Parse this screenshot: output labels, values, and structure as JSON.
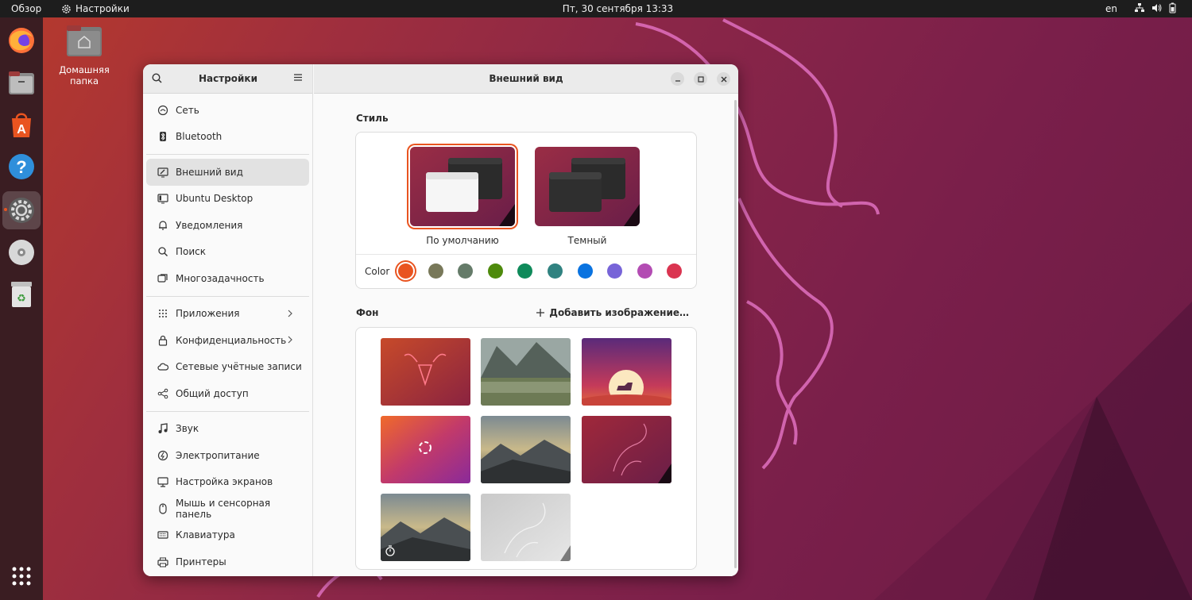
{
  "topbar": {
    "overview": "Обзор",
    "app_name": "Настройки",
    "clock": "Пт, 30 сентября  13:33",
    "lang": "en"
  },
  "desktop": {
    "home_folder": "Домашняя папка"
  },
  "dock": [
    "firefox-icon",
    "files-icon",
    "app-center-icon",
    "help-icon",
    "settings-icon",
    "disc-icon",
    "trash-icon",
    "show-apps-icon"
  ],
  "sidebar": {
    "title": "Настройки",
    "groups": [
      [
        {
          "label": "Сеть",
          "icon": "network-icon"
        },
        {
          "label": "Bluetooth",
          "icon": "bluetooth-icon"
        }
      ],
      [
        {
          "label": "Внешний вид",
          "icon": "appearance-icon",
          "selected": true
        },
        {
          "label": "Ubuntu Desktop",
          "icon": "ubuntu-desktop-icon"
        },
        {
          "label": "Уведомления",
          "icon": "bell-icon"
        },
        {
          "label": "Поиск",
          "icon": "search-icon"
        },
        {
          "label": "Многозадачность",
          "icon": "multitasking-icon"
        }
      ],
      [
        {
          "label": "Приложения",
          "icon": "apps-grid-icon",
          "chevron": true
        },
        {
          "label": "Конфиденциальность",
          "icon": "lock-icon",
          "chevron": true
        },
        {
          "label": "Сетевые учётные записи",
          "icon": "cloud-icon"
        },
        {
          "label": "Общий доступ",
          "icon": "share-icon"
        }
      ],
      [
        {
          "label": "Звук",
          "icon": "music-note-icon"
        },
        {
          "label": "Электропитание",
          "icon": "power-icon"
        },
        {
          "label": "Настройка экранов",
          "icon": "display-icon"
        },
        {
          "label": "Мышь и сенсорная панель",
          "icon": "mouse-icon"
        },
        {
          "label": "Клавиатура",
          "icon": "keyboard-icon"
        },
        {
          "label": "Принтеры",
          "icon": "printer-icon"
        }
      ]
    ]
  },
  "main": {
    "title": "Внешний вид",
    "style_label": "Стиль",
    "style_options": [
      {
        "label": "По умолчанию",
        "selected": true
      },
      {
        "label": "Темный",
        "selected": false
      }
    ],
    "color_label": "Color",
    "colors": [
      "#e95420",
      "#787859",
      "#657b69",
      "#4e8a0c",
      "#0f8a5a",
      "#308280",
      "#0a73e0",
      "#7764d8",
      "#b34cb3",
      "#da3450"
    ],
    "selected_color_index": 0,
    "background_label": "Фон",
    "add_image_label": "Добавить изображение…"
  }
}
